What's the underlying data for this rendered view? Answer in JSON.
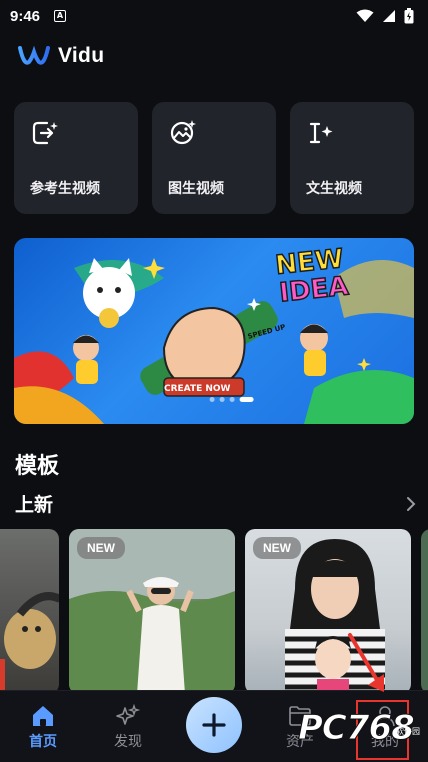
{
  "status": {
    "time": "9:46",
    "notif_glyph": "A"
  },
  "app": {
    "name": "Vidu",
    "brand_color": "#3b8cff"
  },
  "create_cards": [
    {
      "label": "参考生视频",
      "icon": "reference-video-icon"
    },
    {
      "label": "图生视频",
      "icon": "image-to-video-icon"
    },
    {
      "label": "文生视频",
      "icon": "text-to-video-icon"
    }
  ],
  "banner": {
    "headline_line1": "NEW",
    "headline_line2": "IDEA",
    "tag": "SPEED UP",
    "cta": "CREATE NOW",
    "page_count": 4,
    "active_page": 4
  },
  "templates": {
    "section_title": "模板",
    "subsection_title": "上新",
    "badge": "NEW"
  },
  "nav": {
    "home": "首页",
    "discover": "发现",
    "assets": "资产",
    "mine": "我的",
    "active_color": "#5a9bff"
  },
  "watermark": {
    "text": "PC768",
    "sub": "软件园"
  }
}
